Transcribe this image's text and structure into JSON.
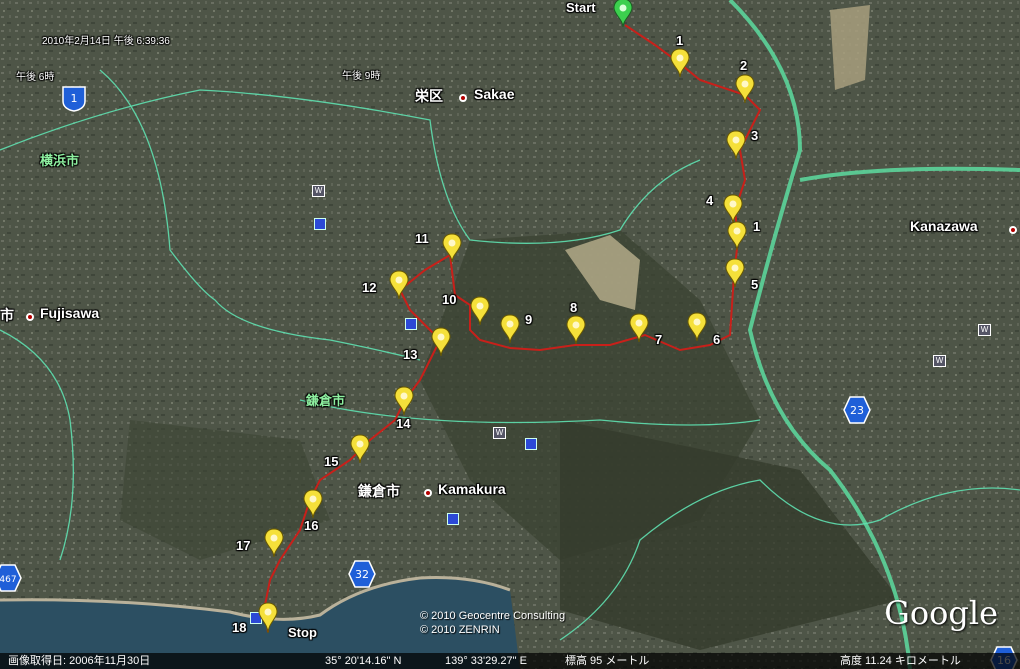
{
  "timestamp": "2010年2月14日 午後  6:39:36",
  "time_labels": {
    "six": "午後  6時",
    "nine": "午後  9時"
  },
  "cities": {
    "sakae_jp": "栄区",
    "sakae": "Sakae",
    "yokohama": "横浜市",
    "fujisawa_jp": "市",
    "fujisawa": "Fujisawa",
    "kamakura_ward": "鎌倉市",
    "kamakura_jp": "鎌倉市",
    "kamakura": "Kamakura",
    "kanazawa": "Kanazawa"
  },
  "route": {
    "start": "Start",
    "stop": "Stop"
  },
  "waypoints": [
    {
      "id": "wp-1a",
      "label": "1"
    },
    {
      "id": "wp-2",
      "label": "2"
    },
    {
      "id": "wp-3",
      "label": "3"
    },
    {
      "id": "wp-4",
      "label": "4"
    },
    {
      "id": "wp-1b",
      "label": "1"
    },
    {
      "id": "wp-5",
      "label": "5"
    },
    {
      "id": "wp-6",
      "label": "6"
    },
    {
      "id": "wp-7",
      "label": "7"
    },
    {
      "id": "wp-8",
      "label": "8"
    },
    {
      "id": "wp-9",
      "label": "9"
    },
    {
      "id": "wp-10",
      "label": "10"
    },
    {
      "id": "wp-11",
      "label": "11"
    },
    {
      "id": "wp-12",
      "label": "12"
    },
    {
      "id": "wp-13",
      "label": "13"
    },
    {
      "id": "wp-14",
      "label": "14"
    },
    {
      "id": "wp-15",
      "label": "15"
    },
    {
      "id": "wp-16",
      "label": "16"
    },
    {
      "id": "wp-17",
      "label": "17"
    },
    {
      "id": "wp-18",
      "label": "18"
    }
  ],
  "road_shields": {
    "r1": "1",
    "r23": "23",
    "r32": "32",
    "r467": "467",
    "r16": "16"
  },
  "credits": {
    "line1": "© 2010 Geocentre Consulting",
    "line2": "© 2010 ZENRIN"
  },
  "logo": "Google",
  "status_bar": {
    "imagery_date": "画像取得日: 2006年11月30日",
    "latitude": "35° 20'14.16\" N",
    "longitude": "139° 33'29.27\" E",
    "elevation": "標高   95 メートル",
    "altitude": "高度   11.24 キロメートル"
  },
  "colors": {
    "route": "#c8201a",
    "pin": "#f5e03a",
    "start_pin": "#3ccf4e",
    "boundary": "#5fe0b0",
    "expressway": "#5cd49a"
  }
}
